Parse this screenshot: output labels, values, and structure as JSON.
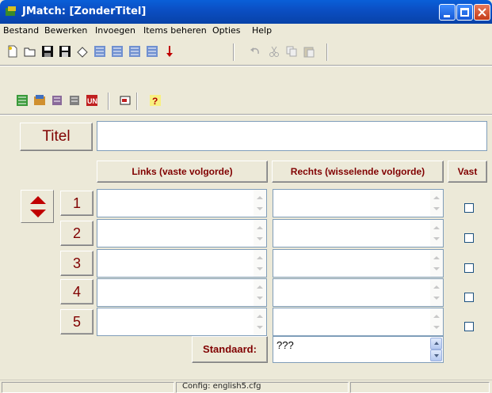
{
  "window": {
    "title": "JMatch: [ZonderTitel]"
  },
  "menu": [
    "Bestand",
    "Bewerken",
    "Invoegen",
    "Items beheren",
    "Opties",
    "Help"
  ],
  "toolbar1_icons": [
    "new-icon",
    "open-icon",
    "save-icon",
    "save-as-icon",
    "clear-icon",
    "export-1-icon",
    "export-2-icon",
    "export-3-icon",
    "export-4-icon",
    "down-arrow-icon",
    "undo-icon",
    "cut-icon",
    "copy-icon",
    "paste-icon"
  ],
  "toolbar2_icons": [
    "tool-a-icon",
    "tool-b-icon",
    "tool-c-icon",
    "tool-d-icon",
    "tool-un-icon",
    "tool-e-icon",
    "help-icon"
  ],
  "form": {
    "titel_label": "Titel",
    "titel_value": "",
    "col_links": "Links (vaste volgorde)",
    "col_rechts": "Rechts (wisselende volgorde)",
    "col_vast": "Vast",
    "rows": [
      "1",
      "2",
      "3",
      "4",
      "5"
    ],
    "standaard_label": "Standaard:",
    "standaard_value": "???"
  },
  "status": {
    "text": "Config: english5.cfg"
  }
}
